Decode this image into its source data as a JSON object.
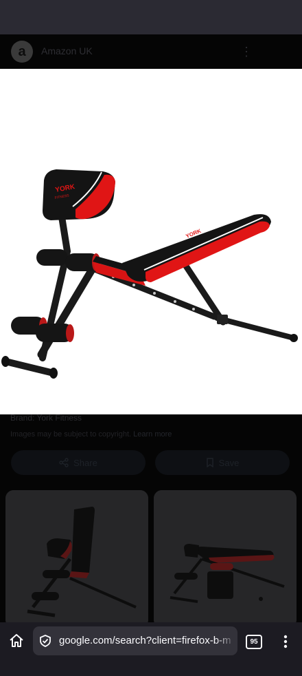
{
  "source": {
    "logo_letter": "a",
    "name": "Amazon UK"
  },
  "hero_image": {
    "brand_text": "YORK",
    "brand_subtext": "FITNESS",
    "colors": {
      "pad_black": "#141414",
      "pad_red": "#e01515",
      "frame": "#1a1a1a"
    }
  },
  "details": {
    "brand": "Brand: York Fitness",
    "copyright": "Images may be subject to copyright.",
    "learn_more": "Learn more"
  },
  "actions": {
    "share_label": "Share",
    "save_label": "Save"
  },
  "browser": {
    "url": "google.com/search?client=firefox-b-m",
    "tab_count": "95",
    "icons": [
      "home-icon",
      "shield-icon",
      "tabs-icon",
      "overflow-menu-icon"
    ]
  }
}
